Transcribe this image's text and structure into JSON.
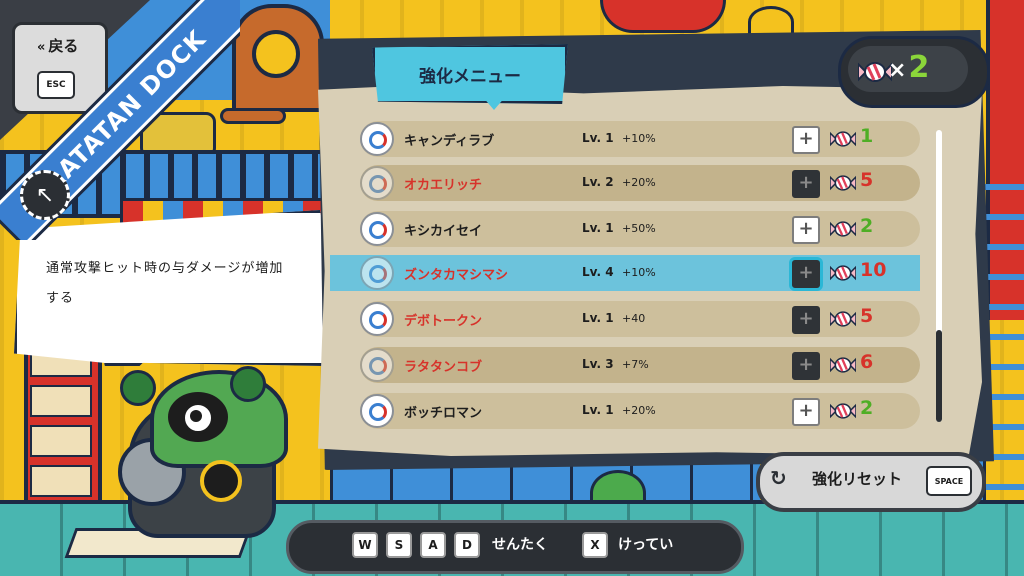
{
  "back": {
    "label": "戻る",
    "key": "ESC"
  },
  "ribbon": {
    "text": "RATATAN DOCK"
  },
  "description": {
    "text": "通常攻撃ヒット時の与ダメージが増加する"
  },
  "menu": {
    "title": "強化メニュー",
    "candy": {
      "prefix": "×",
      "count": "2"
    },
    "items": [
      {
        "name": "キャンディラブ",
        "level": "Lv. 1",
        "bonus": "+10%",
        "cost": "1",
        "affordable": true,
        "icon_dim": false
      },
      {
        "name": "オカエリッチ",
        "level": "Lv. 2",
        "bonus": "+20%",
        "cost": "5",
        "affordable": false,
        "icon_dim": true
      },
      {
        "name": "キシカイセイ",
        "level": "Lv. 1",
        "bonus": "+50%",
        "cost": "2",
        "affordable": true,
        "icon_dim": false
      },
      {
        "name": "ズンタカマシマシ",
        "level": "Lv. 4",
        "bonus": "+10%",
        "cost": "10",
        "affordable": false,
        "icon_dim": true,
        "selected": true
      },
      {
        "name": "デボトークン",
        "level": "Lv. 1",
        "bonus": "+40",
        "cost": "5",
        "affordable": false,
        "icon_dim": false
      },
      {
        "name": "ラタタンコブ",
        "level": "Lv. 3",
        "bonus": "+7%",
        "cost": "6",
        "affordable": false,
        "icon_dim": true
      },
      {
        "name": "ボッチロマン",
        "level": "Lv. 1",
        "bonus": "+20%",
        "cost": "2",
        "affordable": true,
        "icon_dim": false
      }
    ],
    "plus_symbol": "+"
  },
  "reset": {
    "label": "強化リセット",
    "key": "SPACE",
    "icon": "refresh-icon"
  },
  "controls": {
    "keys": [
      "W",
      "S",
      "A",
      "D"
    ],
    "select_label": "せんたく",
    "confirm_key": "X",
    "confirm_label": "けってい"
  },
  "colors": {
    "accent": "#4fc6e0",
    "affordable": "#4fae25",
    "unaffordable": "#d7322a",
    "ribbon": "#3a7fd0"
  }
}
